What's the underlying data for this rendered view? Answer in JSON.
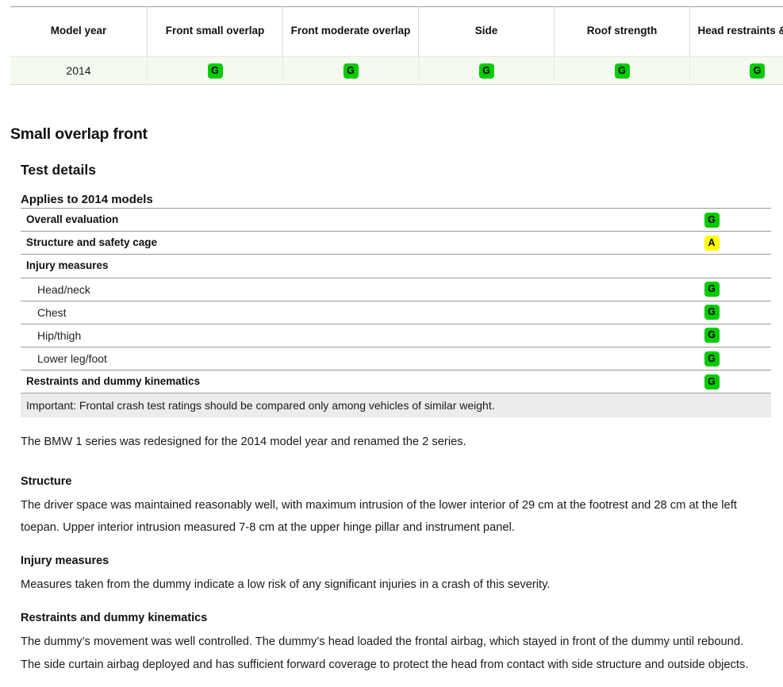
{
  "summary_table": {
    "columns": [
      "Model year",
      "Front small overlap",
      "Front moderate overlap",
      "Side",
      "Roof strength",
      "Head restraints & seats"
    ],
    "rows": [
      {
        "model_year": "2014",
        "front_small_overlap": "G",
        "front_moderate_overlap": "G",
        "side": "G",
        "roof_strength": "G",
        "head_restraints_seats": "G"
      }
    ]
  },
  "section": {
    "title": "Small overlap front",
    "subtitle": "Test details",
    "applies_to": "Applies to 2014 models"
  },
  "detail_rows": [
    {
      "label": "Overall evaluation",
      "rating": "G",
      "level": "main"
    },
    {
      "label": "Structure and safety cage",
      "rating": "A",
      "level": "main"
    },
    {
      "label": "Injury measures",
      "rating": "",
      "level": "main"
    },
    {
      "label": "Head/neck",
      "rating": "G",
      "level": "sub"
    },
    {
      "label": "Chest",
      "rating": "G",
      "level": "sub"
    },
    {
      "label": "Hip/thigh",
      "rating": "G",
      "level": "sub"
    },
    {
      "label": "Lower leg/foot",
      "rating": "G",
      "level": "sub"
    },
    {
      "label": "Restraints and dummy kinematics",
      "rating": "G",
      "level": "main"
    }
  ],
  "important_note": "Important: Frontal crash test ratings should be compared only among vehicles of similar weight.",
  "body": {
    "intro": "The BMW 1 series was redesigned for the 2014 model year and renamed the 2 series.",
    "blocks": [
      {
        "heading": "Structure",
        "text": "The driver space was maintained reasonably well, with maximum intrusion of the lower interior of 29 cm at the footrest and 28 cm at the left toepan. Upper interior intrusion measured 7-8 cm at the upper hinge pillar and instrument panel."
      },
      {
        "heading": "Injury measures",
        "text": "Measures taken from the dummy indicate a low risk of any significant injuries in a crash of this severity."
      },
      {
        "heading": "Restraints and dummy kinematics",
        "text": "The dummy’s movement was well controlled. The dummy’s head loaded the frontal airbag, which stayed in front of the dummy until rebound. The side curtain airbag deployed and has sufficient forward coverage to protect the head from contact with side structure and outside objects."
      }
    ]
  },
  "rating_colors": {
    "good": "#00cc00",
    "acceptable": "#ffff00",
    "marginal": "#ff9900",
    "poor": "#ff0000"
  }
}
